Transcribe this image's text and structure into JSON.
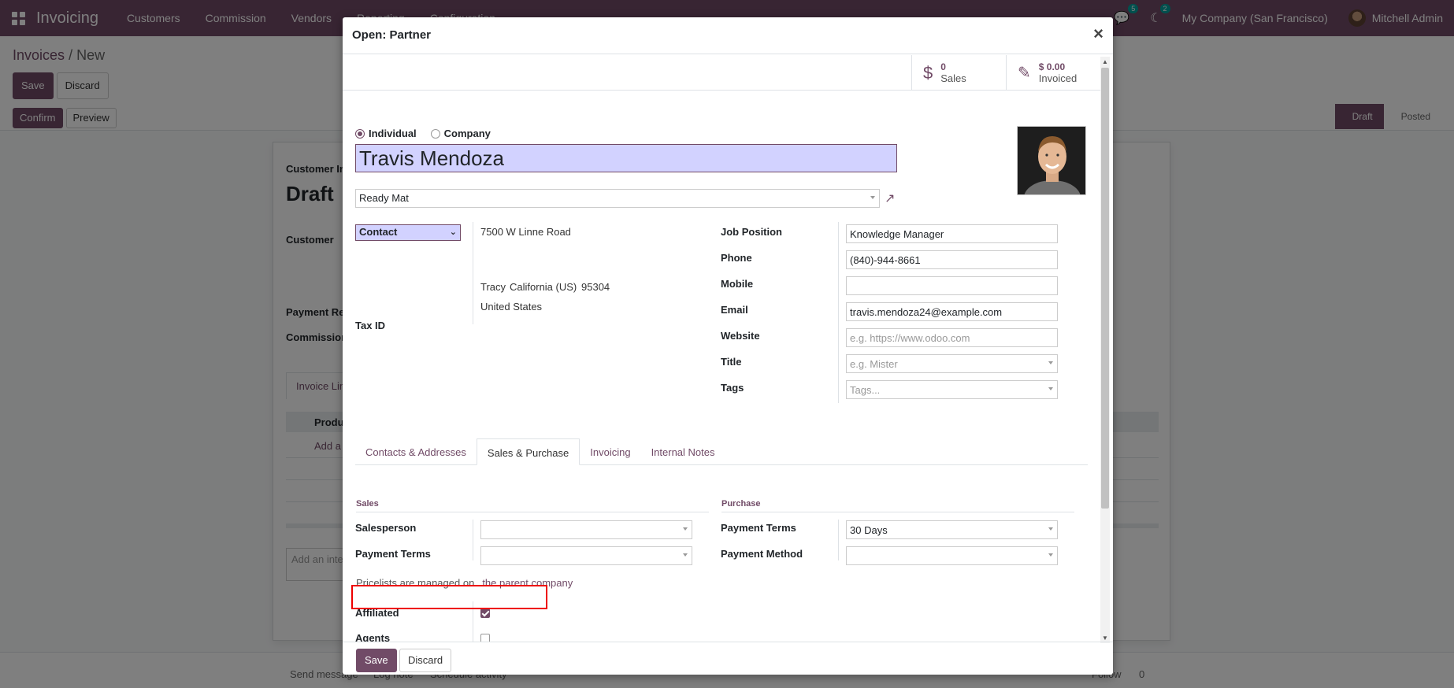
{
  "navbar": {
    "app_name": "Invoicing",
    "menu": [
      "Customers",
      "Commission",
      "Vendors",
      "Reporting",
      "Configuration"
    ],
    "messages_count": "5",
    "activities_count": "2",
    "company": "My Company (San Francisco)",
    "user": "Mitchell Admin"
  },
  "control_panel": {
    "breadcrumb_parent": "Invoices",
    "breadcrumb_sep": "/",
    "breadcrumb_current": "New",
    "save_label": "Save",
    "discard_label": "Discard",
    "confirm_label": "Confirm",
    "preview_label": "Preview",
    "status": [
      "Draft",
      "Posted"
    ]
  },
  "background_sheet": {
    "doc_type": "Customer Invoice",
    "title": "Draft",
    "customer_label": "Customer",
    "payment_ref_label": "Payment Reference",
    "commission_label": "Commission",
    "tab_label": "Invoice Lines",
    "product_col": "Product",
    "add_line": "Add a line",
    "notes_placeholder": "Add an internal note..."
  },
  "chatter": {
    "send_message": "Send message",
    "log_note": "Log note",
    "schedule": "Schedule activity",
    "follow": "Follow",
    "followers": "0"
  },
  "modal": {
    "title": "Open: Partner",
    "stat_buttons": [
      {
        "value": "0",
        "label": "Sales",
        "icon": "dollar-icon"
      },
      {
        "value": "$ 0.00",
        "label": "Invoiced",
        "icon": "edit-icon"
      }
    ],
    "type_options": [
      "Individual",
      "Company"
    ],
    "selected_type": "Individual",
    "name": "Travis Mendoza",
    "parent_company": "Ready Mat",
    "address_type": "Contact",
    "address": {
      "street": "7500 W Linne Road",
      "city": "Tracy",
      "state": "California (US)",
      "zip": "95304",
      "country": "United States"
    },
    "tax_id_label": "Tax ID",
    "fields": {
      "job_position_label": "Job Position",
      "job_position": "Knowledge Manager",
      "phone_label": "Phone",
      "phone": "(840)-944-8661",
      "mobile_label": "Mobile",
      "mobile": "",
      "email_label": "Email",
      "email": "travis.mendoza24@example.com",
      "website_label": "Website",
      "website_placeholder": "e.g. https://www.odoo.com",
      "title_label": "Title",
      "title_placeholder": "e.g. Mister",
      "tags_label": "Tags",
      "tags_placeholder": "Tags..."
    },
    "tabs": [
      "Contacts & Addresses",
      "Sales & Purchase",
      "Invoicing",
      "Internal Notes"
    ],
    "active_tab": "Sales & Purchase",
    "sales": {
      "heading": "Sales",
      "salesperson_label": "Salesperson",
      "salesperson": "",
      "payment_terms_label": "Payment Terms",
      "payment_terms": ""
    },
    "purchase": {
      "heading": "Purchase",
      "payment_terms_label": "Payment Terms",
      "payment_terms": "30 Days",
      "payment_method_label": "Payment Method",
      "payment_method": ""
    },
    "pricelist_note": "Pricelists are managed on",
    "pricelist_link": "the parent company",
    "affiliated_label": "Affiliated",
    "affiliated_checked": true,
    "agents_label": "Agents",
    "agents_checked": false,
    "save_label": "Save",
    "discard_label": "Discard",
    "close_symbol": "×"
  },
  "colors": {
    "brand": "#714b67",
    "required_field_bg": "#d2d2ff",
    "highlight_border": "#ee0000"
  }
}
